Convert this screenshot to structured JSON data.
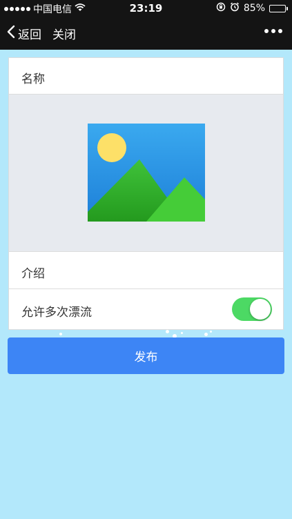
{
  "status_bar": {
    "carrier": "中国电信",
    "time": "23:19",
    "battery": "85%",
    "battery_level": 0.85
  },
  "nav": {
    "back_label": "返回",
    "close_label": "关闭"
  },
  "form": {
    "name_label": "名称",
    "intro_label": "介绍",
    "toggle_label": "允许多次漂流",
    "toggle_on": true
  },
  "publish_label": "发布",
  "colors": {
    "background": "#b3e8fb",
    "bar": "#141414",
    "toggle_on": "#4cd964",
    "button": "#3d85f5"
  }
}
